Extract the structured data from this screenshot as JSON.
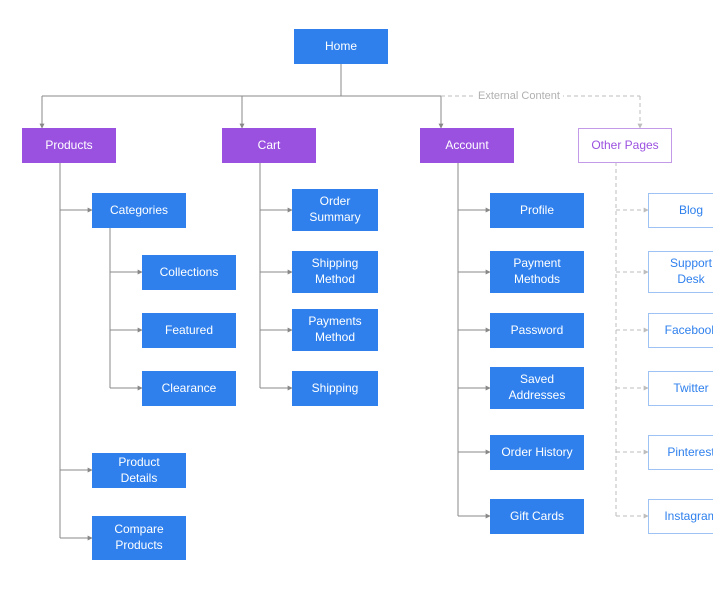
{
  "root": {
    "label": "Home"
  },
  "external_label": "External Content",
  "columns": [
    {
      "id": "products",
      "header": "Products",
      "children": [
        {
          "id": "categories",
          "label": "Categories",
          "children": [
            {
              "id": "collections",
              "label": "Collections"
            },
            {
              "id": "featured",
              "label": "Featured"
            },
            {
              "id": "clearance",
              "label": "Clearance"
            }
          ]
        },
        {
          "id": "product-details",
          "label": "Product Details"
        },
        {
          "id": "compare-products",
          "label": "Compare Products"
        }
      ]
    },
    {
      "id": "cart",
      "header": "Cart",
      "children": [
        {
          "id": "order-summary",
          "label": "Order Summary"
        },
        {
          "id": "shipping-method",
          "label": "Shipping Method"
        },
        {
          "id": "payments-method",
          "label": "Payments Method"
        },
        {
          "id": "shipping",
          "label": "Shipping"
        }
      ]
    },
    {
      "id": "account",
      "header": "Account",
      "children": [
        {
          "id": "profile",
          "label": "Profile"
        },
        {
          "id": "payment-methods",
          "label": "Payment Methods"
        },
        {
          "id": "password",
          "label": "Password"
        },
        {
          "id": "saved-addresses",
          "label": "Saved Addresses"
        },
        {
          "id": "order-history",
          "label": "Order History"
        },
        {
          "id": "gift-cards",
          "label": "Gift Cards"
        }
      ]
    },
    {
      "id": "other-pages",
      "header": "Other Pages",
      "external": true,
      "children": [
        {
          "id": "blog",
          "label": "Blog"
        },
        {
          "id": "support-desk",
          "label": "Support Desk"
        },
        {
          "id": "facebook",
          "label": "Facebook"
        },
        {
          "id": "twitter",
          "label": "Twitter"
        },
        {
          "id": "pinterest",
          "label": "Pinterest"
        },
        {
          "id": "instagram",
          "label": "Instagram"
        }
      ]
    }
  ],
  "colors": {
    "blue": "#2f80ed",
    "purple": "#9B51E0",
    "solid_edge": "#888888",
    "dashed_edge": "#bdbdbd"
  }
}
